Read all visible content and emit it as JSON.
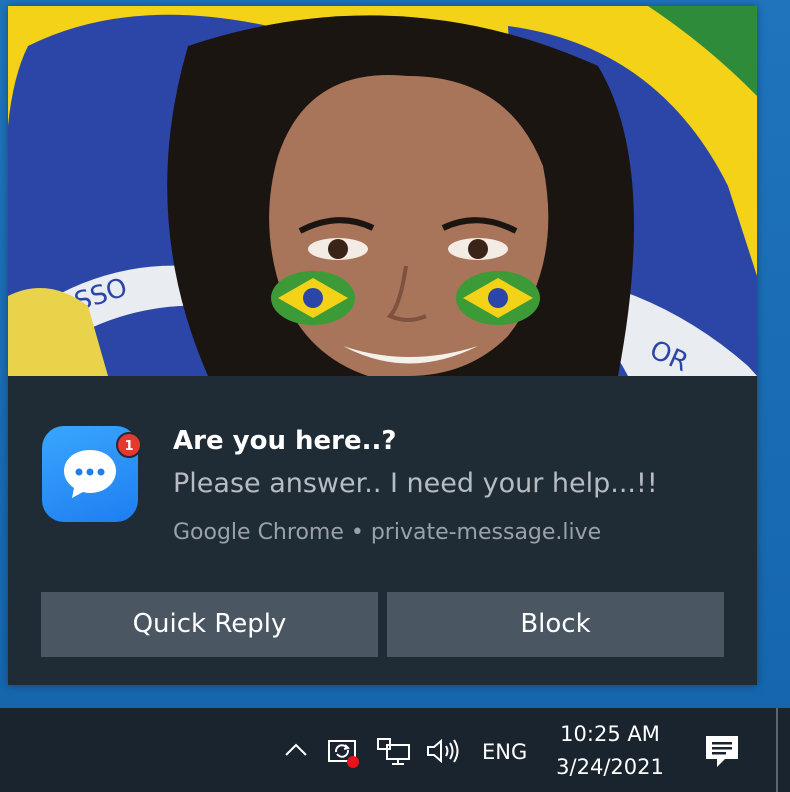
{
  "notification": {
    "title": "Are you here..?",
    "message": "Please answer.. I need your help...!!",
    "attribution": "Google Chrome • private-message.live",
    "badge_count": "1",
    "app_icon": "chat-bubble-icon",
    "actions": [
      {
        "label": "Quick Reply"
      },
      {
        "label": "Block"
      }
    ]
  },
  "taskbar": {
    "icons": [
      "chevron-up-icon",
      "sync-icon",
      "network-icon",
      "volume-icon",
      "action-center-icon"
    ],
    "language": "ENG",
    "time": "10:25 AM",
    "date": "3/24/2021"
  },
  "colors": {
    "toast_bg": "#1f2b35",
    "button_bg": "#4a5763",
    "badge": "#e5392f",
    "taskbar_bg": "#1a242e",
    "desktop_accent": "#1a6fb5"
  }
}
